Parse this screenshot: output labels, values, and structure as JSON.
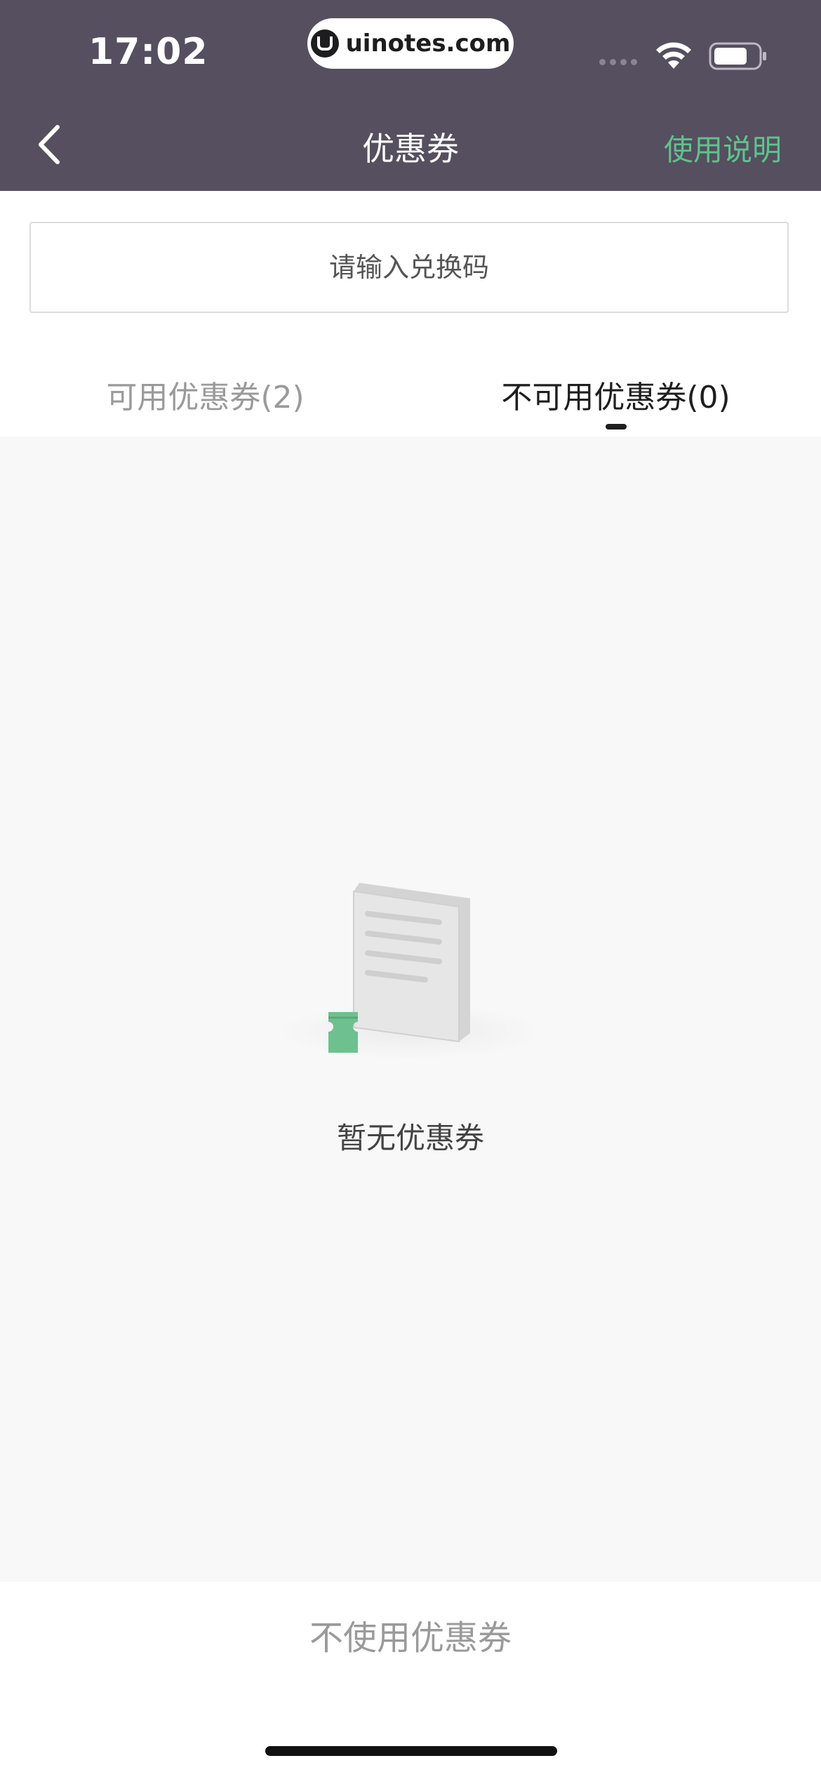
{
  "status_bar": {
    "time": "17:02",
    "url": "uinotes.com"
  },
  "nav": {
    "title": "优惠券",
    "help_label": "使用说明"
  },
  "redeem": {
    "placeholder": "请输入兑换码",
    "value": ""
  },
  "tabs": [
    {
      "label": "可用优惠券(2)",
      "active": false
    },
    {
      "label": "不可用优惠券(0)",
      "active": true
    }
  ],
  "empty_state": {
    "message": "暂无优惠券"
  },
  "bottom": {
    "no_coupon_label": "不使用优惠券"
  },
  "colors": {
    "header_bg": "#554f5f",
    "accent": "#5fc28c",
    "content_bg": "#f8f8f8"
  },
  "icons": [
    "back-arrow-icon",
    "wifi-icon",
    "battery-icon",
    "signal-icon",
    "document-icon",
    "ticket-icon"
  ]
}
